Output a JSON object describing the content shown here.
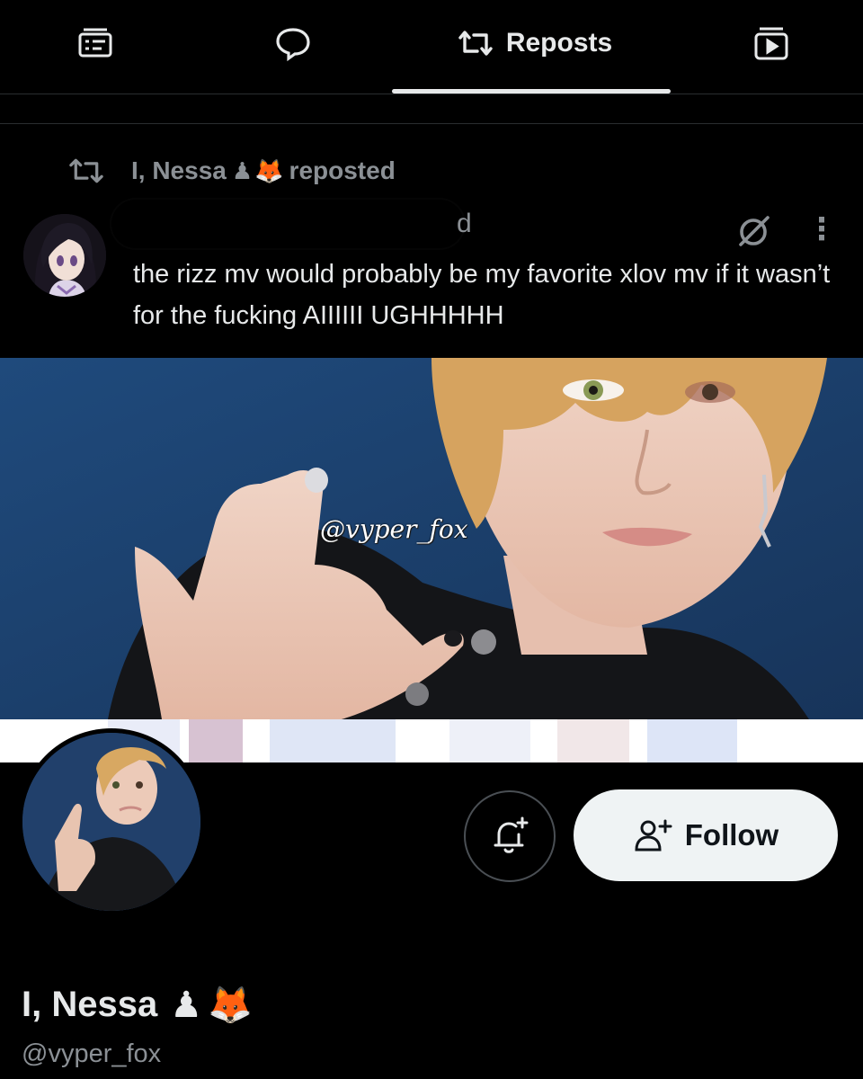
{
  "tabs": {
    "active_label": "Reposts",
    "items": [
      {
        "icon": "highlights-icon"
      },
      {
        "icon": "replies-icon"
      },
      {
        "icon": "repost-icon",
        "label": "Reposts"
      },
      {
        "icon": "video-icon"
      }
    ]
  },
  "repost": {
    "user": "I, Nessa",
    "emoji_1": "♟",
    "emoji_2": "🦊",
    "action": "reposted"
  },
  "tweet": {
    "time": "d",
    "text": "the rizz mv would probably be my favorite xlov mv if it wasn’t for the fucking AIIIIII UGHHHHH",
    "more_icon": "⋮"
  },
  "media": {
    "watermark": "@vyper_fox"
  },
  "profile": {
    "follow_label": "Follow",
    "display_name": "I, Nessa",
    "name_emoji_1": "♟",
    "name_emoji_2": "🦊",
    "handle": "@vyper_fox"
  },
  "colors": {
    "background": "#000000",
    "text": "#e7e9ea",
    "muted": "#8b9095",
    "follow_button": "#eff3f4",
    "media_bg": "#1d3f6b"
  }
}
